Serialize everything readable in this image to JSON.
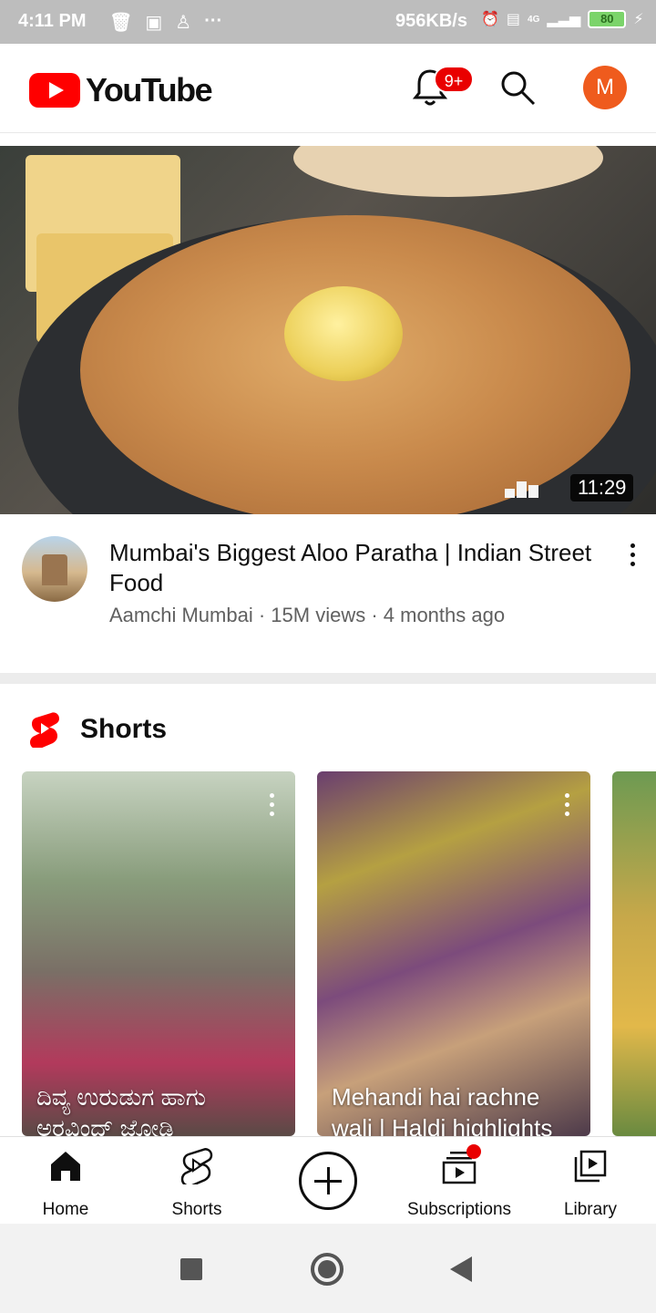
{
  "status_bar": {
    "time": "4:11 PM",
    "speed": "956KB/s",
    "network": "4G",
    "battery": "80"
  },
  "app_bar": {
    "logo_text": "YouTube",
    "notification_badge": "9+",
    "account_initial": "M",
    "colors": {
      "brand": "#ff0000",
      "avatar": "#ef5b1d",
      "badge": "#e90000"
    }
  },
  "video": {
    "duration": "11:29",
    "title": "Mumbai's Biggest Aloo Paratha | Indian Street Food",
    "channel": "Aamchi Mumbai",
    "views": "15M views",
    "age": "4 months ago"
  },
  "shorts": {
    "heading": "Shorts",
    "items": [
      {
        "caption": "ದಿವ್ಯ ಉರುಡುಗ ಹಾಗು ಅರವಿಂದ್ ಜೋಡಿ"
      },
      {
        "caption": "Mehandi hai rachne wali | Haldi highlights"
      },
      {
        "caption": ""
      }
    ]
  },
  "bottom_nav": [
    {
      "label": "Home",
      "icon": "home-icon"
    },
    {
      "label": "Shorts",
      "icon": "shorts-icon"
    },
    {
      "label": "",
      "icon": "create-icon"
    },
    {
      "label": "Subscriptions",
      "icon": "subscriptions-icon"
    },
    {
      "label": "Library",
      "icon": "library-icon"
    }
  ]
}
